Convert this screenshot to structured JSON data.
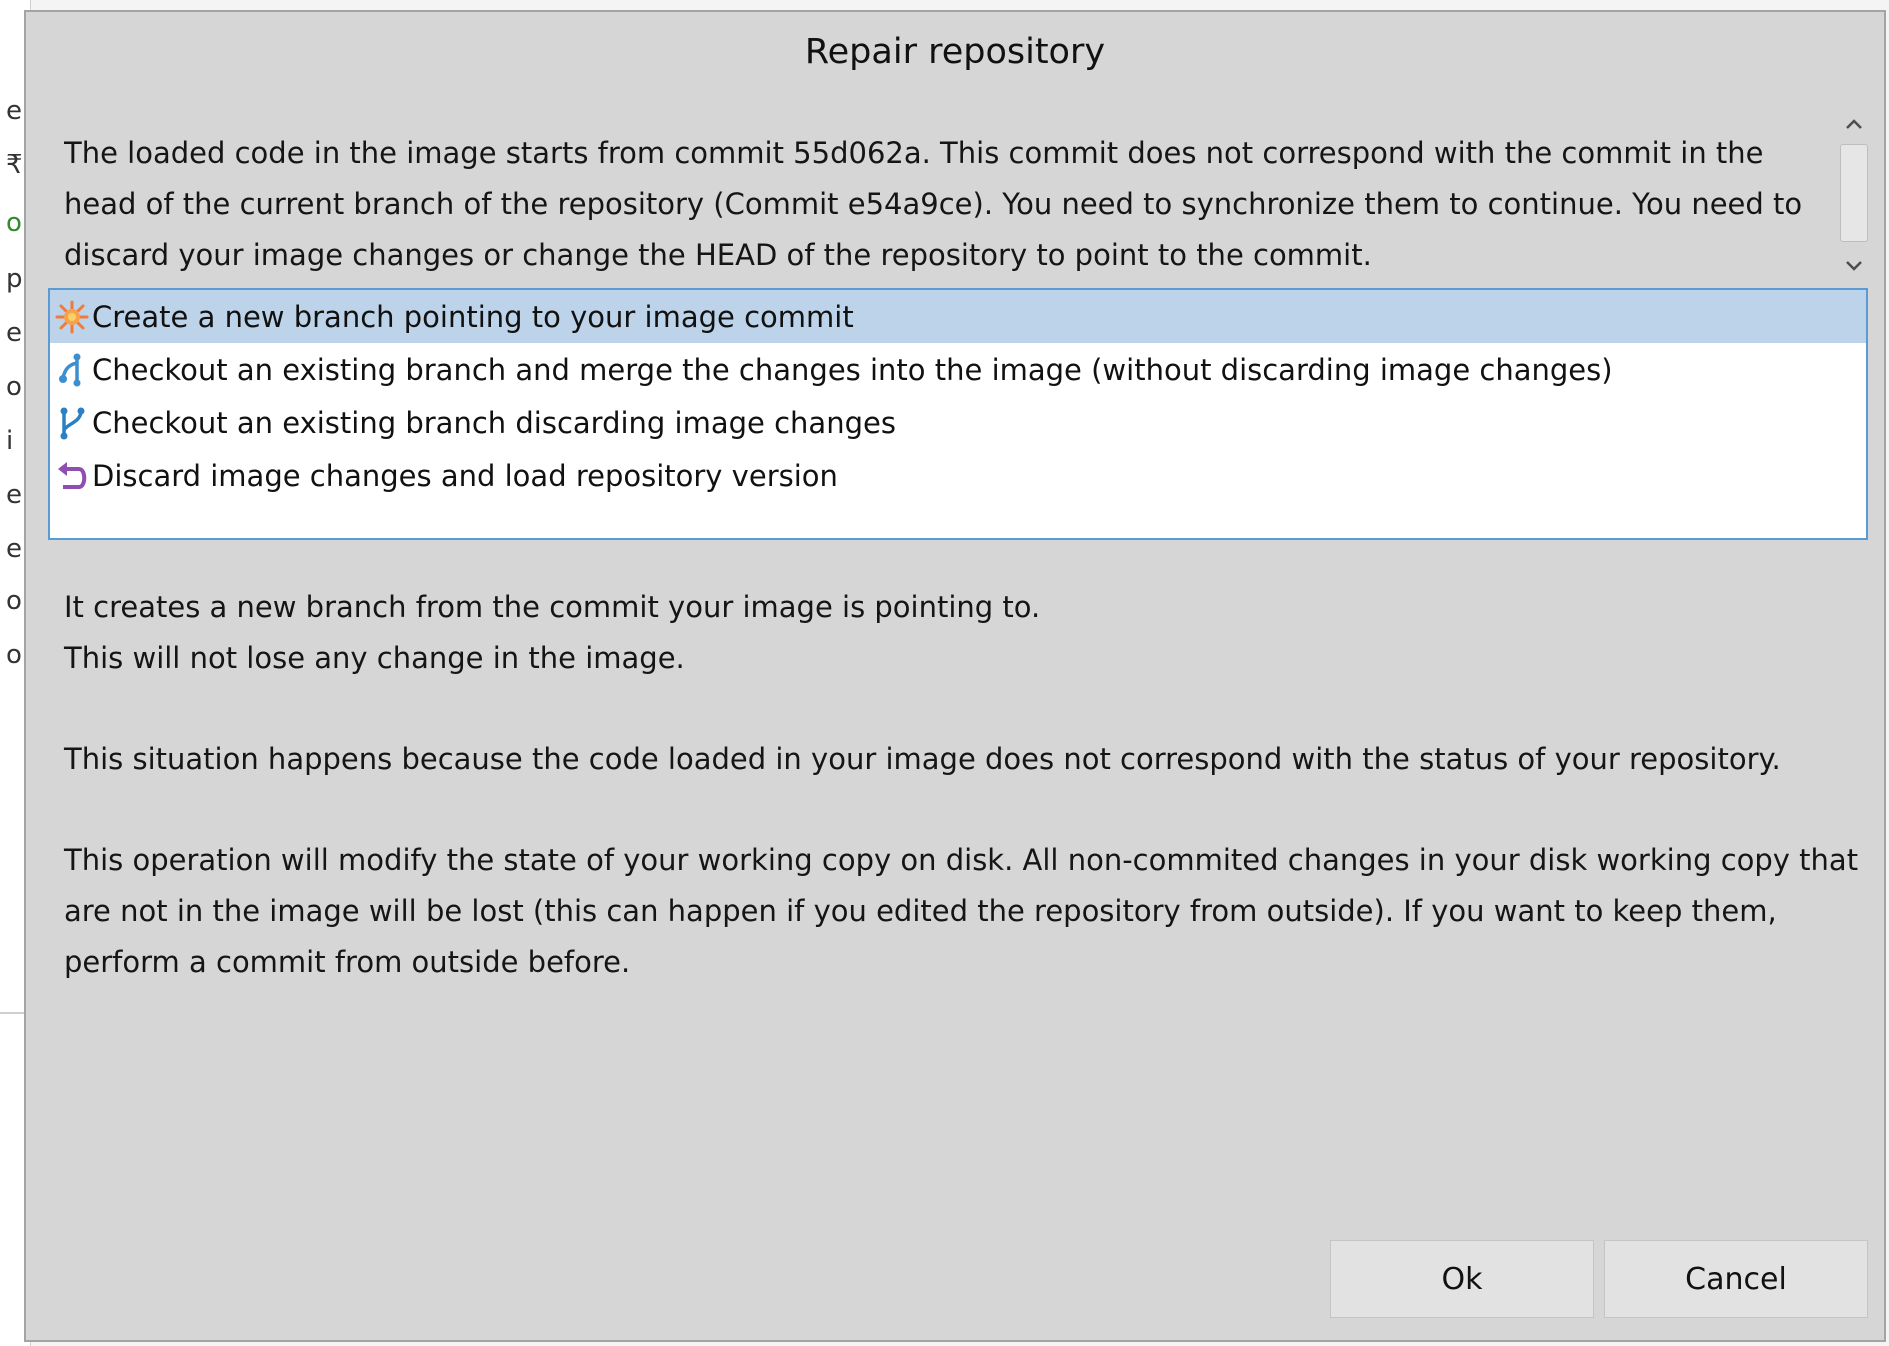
{
  "dialog": {
    "title": "Repair repository",
    "message": "The loaded code in the image starts from commit 55d062a. This commit does not correspond with the commit in the head of the current branch of the repository (Commit e54a9ce). You need to synchronize them to continue. You need to discard your image changes or change the HEAD of the repository to point to the commit.",
    "options": [
      {
        "label": "Create a new branch pointing to your image commit",
        "icon": "new-branch-icon",
        "selected": true
      },
      {
        "label": "Checkout an existing branch and merge the changes into the image (without discarding image changes)",
        "icon": "merge-icon",
        "selected": false
      },
      {
        "label": "Checkout an existing branch discarding image changes",
        "icon": "branch-icon",
        "selected": false
      },
      {
        "label": "Discard image changes and load repository version",
        "icon": "undo-icon",
        "selected": false
      }
    ],
    "description": {
      "line1": "It creates a new branch from the commit your image is pointing to.",
      "line2": "This will not lose any change in the image.",
      "para2": "This situation happens because the code loaded in your image does not correspond with the status of your repository.",
      "para3": "This operation will modify the state of your working copy on disk. All non-commited changes in your disk working copy that are not in the image will be lost (this can happen if you edited the repository from outside). If you want to keep them, perform a commit from outside before."
    },
    "buttons": {
      "ok": "Ok",
      "cancel": "Cancel"
    }
  },
  "background": {
    "fragments": [
      "e",
      "₹e",
      "o",
      "p",
      "e",
      "o",
      "i",
      "e",
      "e",
      "o",
      "o"
    ]
  },
  "colors": {
    "dialog_bg": "#d6d6d6",
    "selection": "#bdd3ea",
    "list_border": "#5b9bd5",
    "new_branch_icon": "#f07a3a",
    "merge_icon": "#3b8fd0",
    "branch_icon": "#2b7fc4",
    "undo_icon": "#8e4fb0"
  }
}
